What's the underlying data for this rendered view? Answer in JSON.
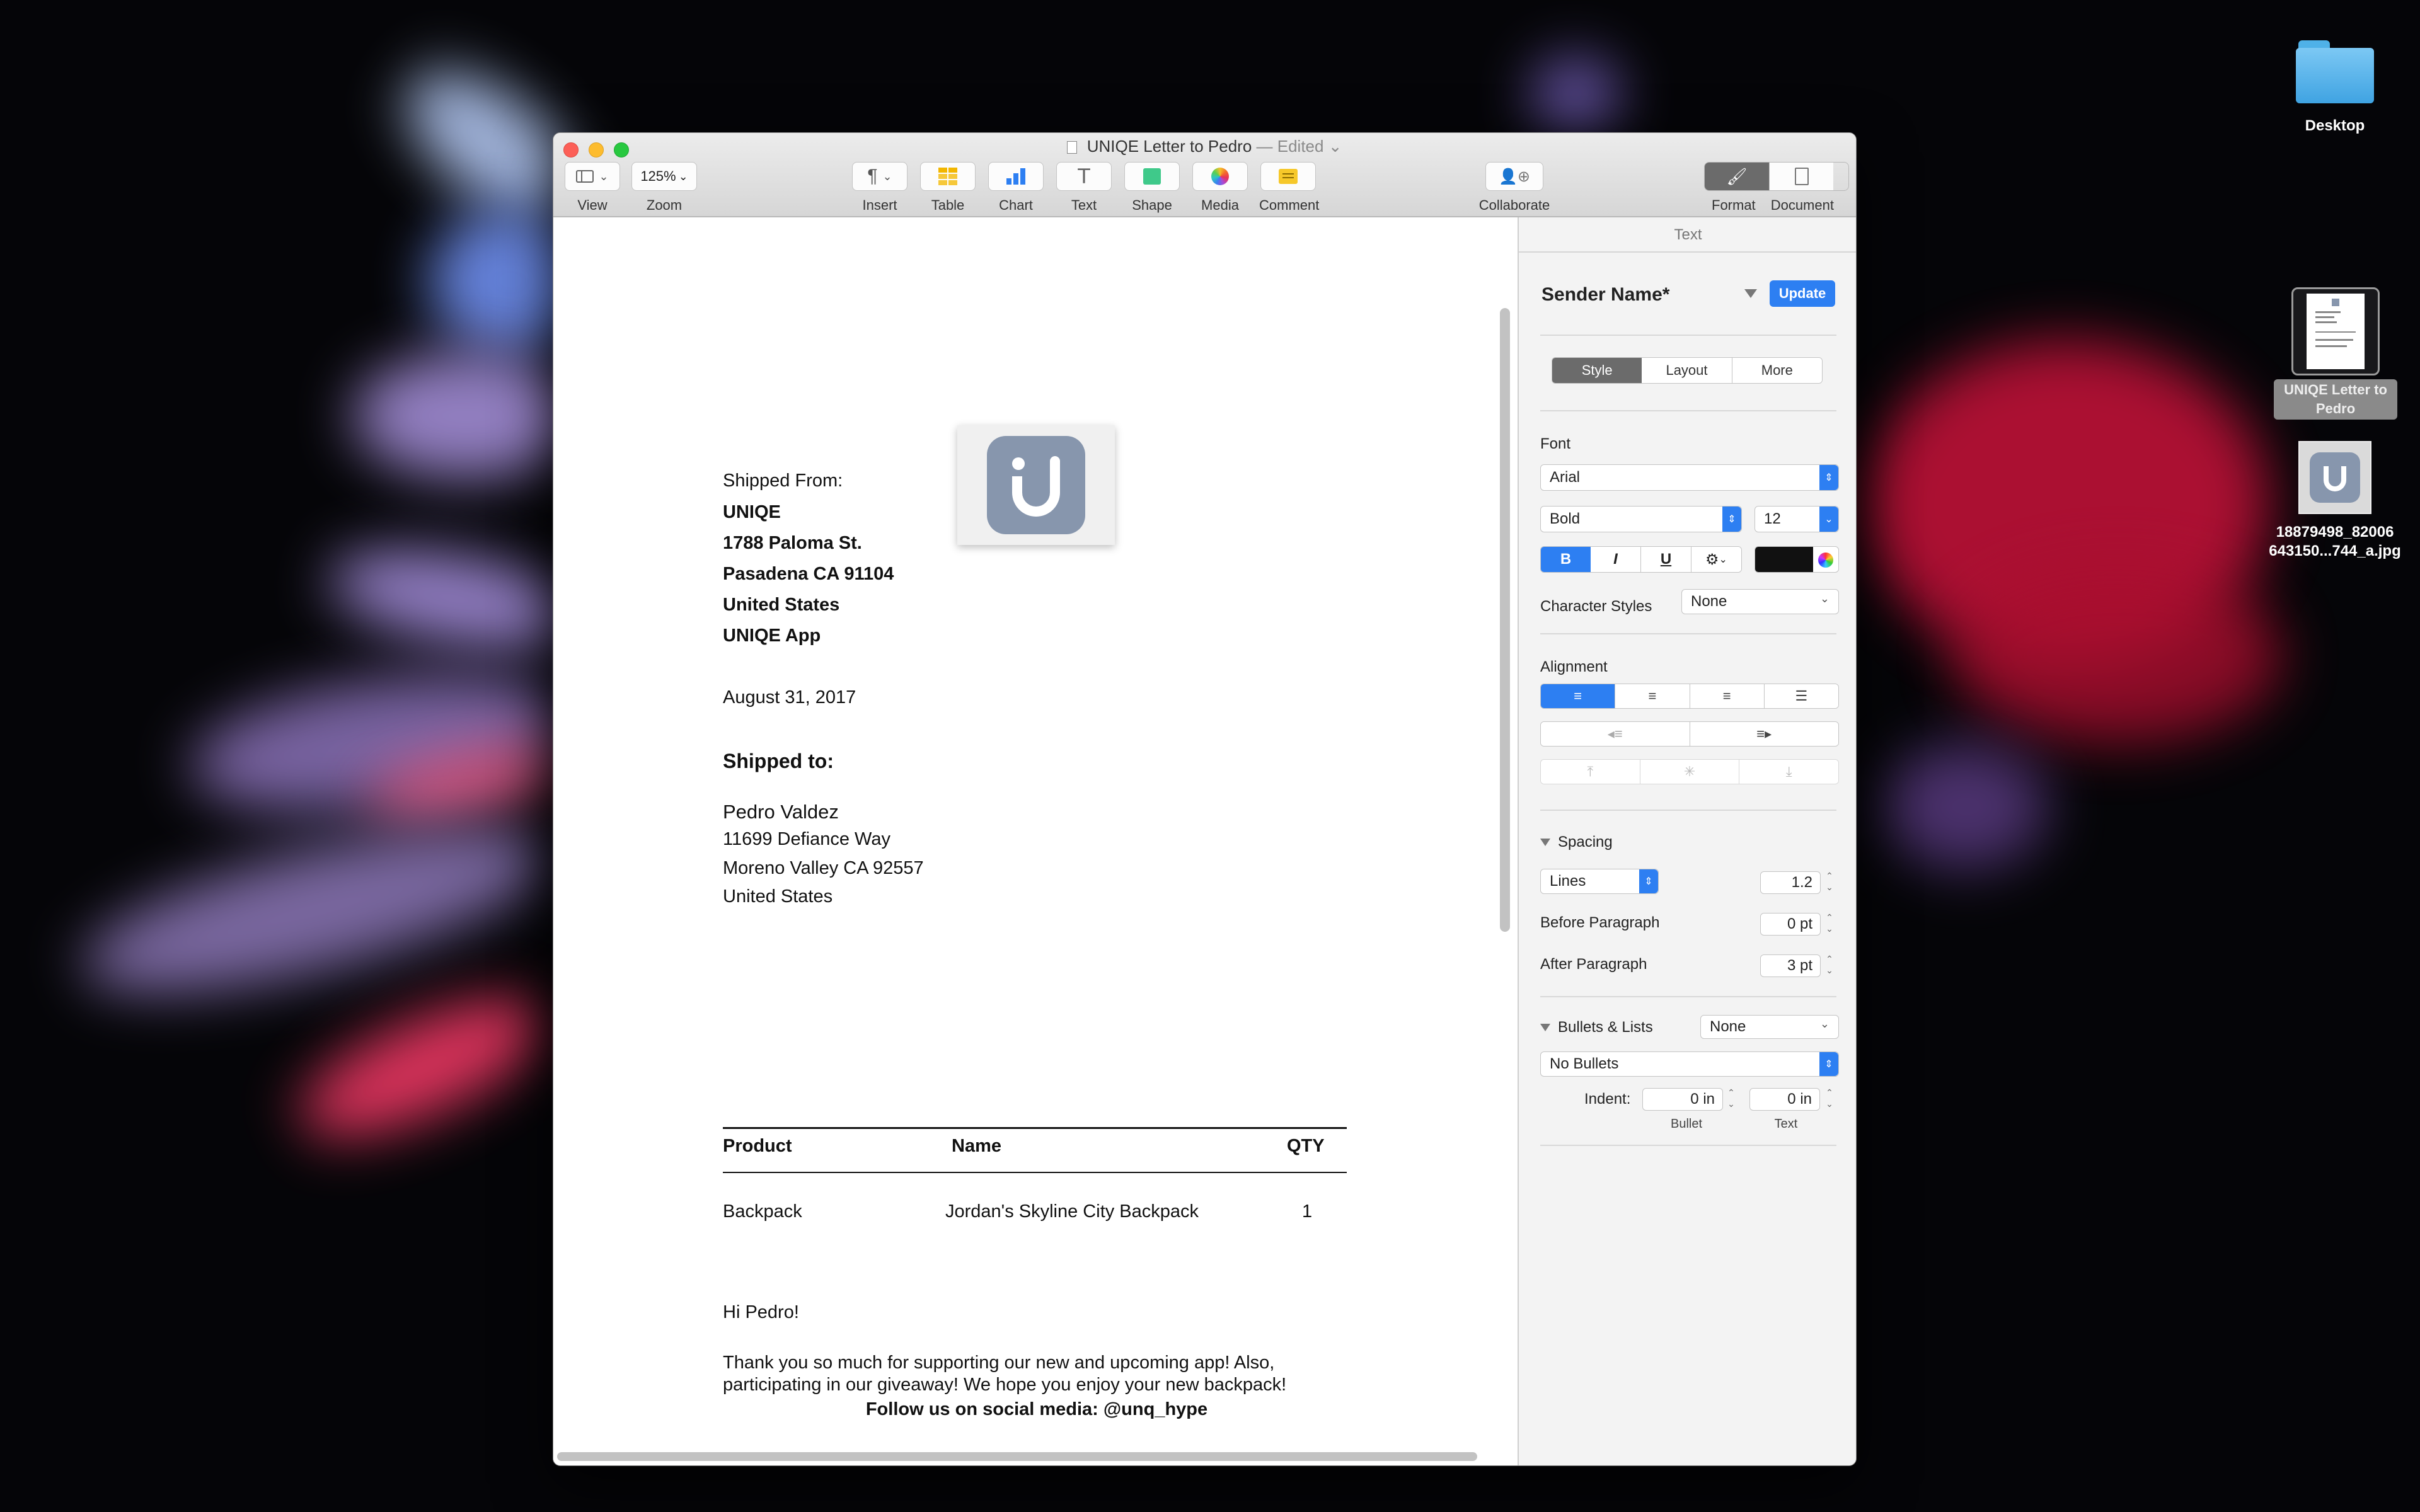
{
  "window": {
    "title": "UNIQE Letter to Pedro",
    "title_status": "— Edited"
  },
  "toolbar": {
    "view_label": "View",
    "zoom_value": "125%",
    "zoom_label": "Zoom",
    "insert_label": "Insert",
    "table_label": "Table",
    "chart_label": "Chart",
    "text_label": "Text",
    "shape_label": "Shape",
    "media_label": "Media",
    "comment_label": "Comment",
    "collaborate_label": "Collaborate",
    "format_label": "Format",
    "document_label": "Document"
  },
  "document": {
    "shipped_from_label": "Shipped From:",
    "sender": [
      "UNIQE",
      "1788 Paloma St.",
      "Pasadena CA 91104",
      "United States",
      "UNIQE App"
    ],
    "date": "August 31, 2017",
    "shipped_to_label": "Shipped to:",
    "recipient": [
      "Pedro Valdez",
      "11699 Defiance Way",
      "Moreno Valley CA 92557",
      "United States"
    ],
    "table": {
      "headers": [
        "Product",
        "Name",
        "QTY"
      ],
      "rows": [
        [
          "Backpack",
          "Jordan's Skyline City Backpack",
          "1"
        ]
      ]
    },
    "greeting": "Hi Pedro!",
    "body_lines": [
      "Thank you so much for supporting our new and upcoming app! Also,",
      "participating in our giveaway! We hope you enjoy your new backpack!"
    ],
    "footer": "Follow us on social media: @unq_hype"
  },
  "sidebar": {
    "header": "Text",
    "style_name": "Sender Name*",
    "update_button": "Update",
    "tabs": [
      "Style",
      "Layout",
      "More"
    ],
    "font_label": "Font",
    "font_family": "Arial",
    "font_weight": "Bold",
    "font_size": "12",
    "bold": "B",
    "italic": "I",
    "underline": "U",
    "text_color": "#111111",
    "character_styles_label": "Character Styles",
    "character_styles_value": "None",
    "alignment_label": "Alignment",
    "spacing_label": "Spacing",
    "spacing_mode": "Lines",
    "spacing_value": "1.2",
    "before_paragraph_label": "Before Paragraph",
    "before_paragraph_value": "0 pt",
    "after_paragraph_label": "After Paragraph",
    "after_paragraph_value": "3 pt",
    "bullets_label": "Bullets & Lists",
    "bullets_value": "None",
    "bullets_style": "No Bullets",
    "indent_label": "Indent:",
    "indent_bullet_value": "0 in",
    "indent_text_value": "0 in",
    "indent_bullet_label": "Bullet",
    "indent_text_label": "Text"
  },
  "desktop": {
    "icons": [
      {
        "label": "Desktop",
        "type": "folder"
      },
      {
        "label": "UNIQE Letter to Pedro",
        "type": "pages-document"
      },
      {
        "label": "18879498_82006 643150...744_a.jpg",
        "type": "image"
      }
    ]
  },
  "colors": {
    "accent": "#2d7ff2",
    "logo": "#8796ad",
    "close": "#fc5f57",
    "minimize": "#fdbc2e",
    "zoom": "#28c840"
  }
}
